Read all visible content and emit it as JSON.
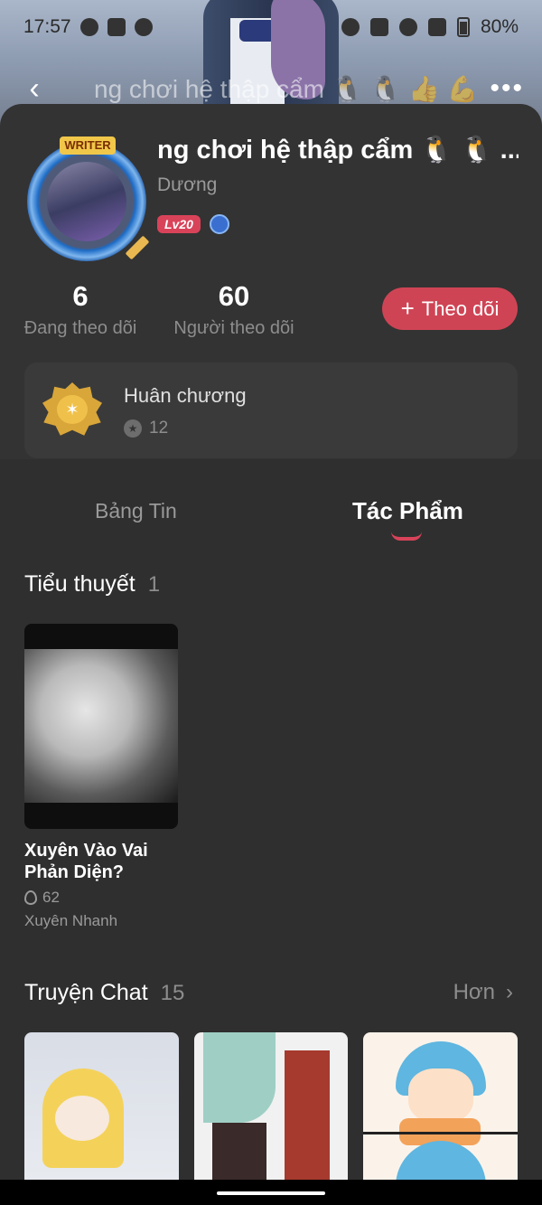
{
  "status_bar": {
    "time": "17:57",
    "battery": "80%"
  },
  "nav": {
    "title": "ng chơi hệ thập cẩm 🐧 🐧 👍 💪",
    "back_icon": "back-arrow-icon",
    "more_icon": "more-dots-icon"
  },
  "profile": {
    "avatar_tag": "WRITER",
    "name": "ng chơi hệ thập cẩm 🐧 🐧 ...",
    "handle": "Dương",
    "level": "Lv20",
    "stats": [
      {
        "value": "6",
        "label": "Đang theo dõi"
      },
      {
        "value": "60",
        "label": "Người theo dõi"
      }
    ],
    "follow_button": {
      "plus": "+",
      "label": "Theo dõi"
    },
    "medals": {
      "title": "Huân chương",
      "count": "12"
    }
  },
  "tabs": {
    "news": "Bảng Tin",
    "works": "Tác Phẩm",
    "active": "works"
  },
  "novels": {
    "title": "Tiểu thuyết",
    "count": "1",
    "items": [
      {
        "title": "Xuyên Vào Vai Phản Diện?",
        "views": "62",
        "author": "Xuyên Nhanh"
      }
    ]
  },
  "chat_stories": {
    "title": "Truyện Chat",
    "count": "15",
    "more_label": "Hơn"
  },
  "colors": {
    "accent": "#cf4455",
    "background": "#2f2f2f",
    "card": "#3a3a3a"
  }
}
